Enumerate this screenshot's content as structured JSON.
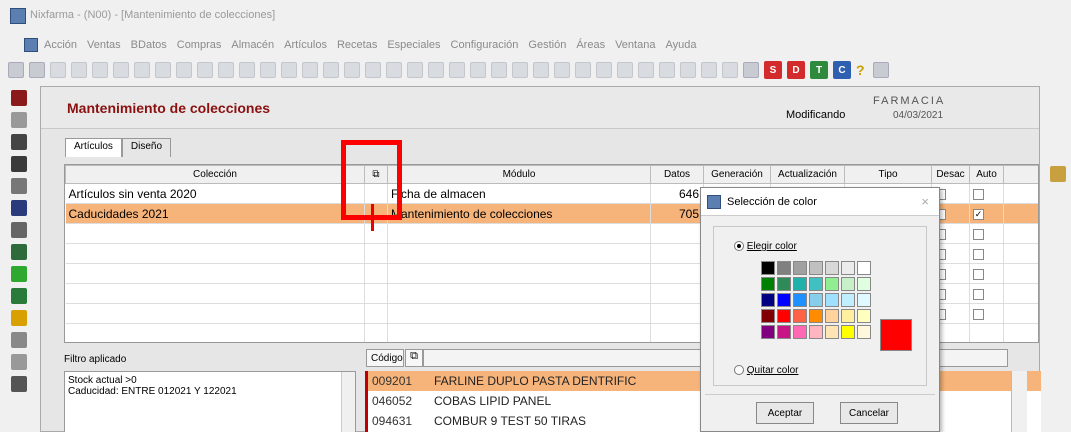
{
  "window": {
    "title": "Nixfarma - (N00) - [Mantenimiento de colecciones]"
  },
  "menu": [
    "Acción",
    "Ventas",
    "BDatos",
    "Compras",
    "Almacén",
    "Artículos",
    "Recetas",
    "Especiales",
    "Configuración",
    "Gestión",
    "Áreas",
    "Ventana",
    "Ayuda"
  ],
  "toolbar": {
    "help_glyph": "?"
  },
  "form": {
    "title": "Mantenimiento de colecciones",
    "mode": "Modificando",
    "pharmacy": "FARMACIA",
    "date": "04/03/2021"
  },
  "tabs": [
    "Artículos",
    "Diseño"
  ],
  "grid": {
    "columns": [
      "Colección",
      "Módulo",
      "Datos",
      "Generación",
      "Actualización",
      "Tipo",
      "Desac",
      "Auto"
    ],
    "rows": [
      {
        "coleccion": "Artículos sin venta 2020",
        "modulo": "Ficha de almacen",
        "datos": "646",
        "auto": ""
      },
      {
        "coleccion": "Caducidades 2021",
        "modulo": "Mantenimiento de colecciones",
        "datos": "705",
        "auto": "✓"
      }
    ]
  },
  "filter": {
    "label": "Filtro aplicado",
    "lines": [
      "Stock actual >0",
      "Caducidad: ENTRE 012021 Y 122021"
    ]
  },
  "products": {
    "header": "Código",
    "rows": [
      {
        "code": "009201",
        "name": "FARLINE DUPLO PASTA DENTRIFIC"
      },
      {
        "code": "046052",
        "name": "COBAS LIPID PANEL"
      },
      {
        "code": "094631",
        "name": "COMBUR 9 TEST 50 TIRAS"
      }
    ]
  },
  "color_dialog": {
    "title": "Selección de color",
    "close": "×",
    "option_choose": "Elegir color",
    "option_remove": "Quitar color",
    "accept": "Aceptar",
    "cancel": "Cancelar",
    "selected_color": "#ff0000",
    "palette": [
      "#000000",
      "#808080",
      "#a0a0a0",
      "#c0c0c0",
      "#d8d8d8",
      "#ececec",
      "#ffffff",
      "#008000",
      "#2e8b57",
      "#20b2aa",
      "#40c0c0",
      "#90ee90",
      "#c8f0c8",
      "#e0ffe0",
      "#000080",
      "#0000ff",
      "#1e90ff",
      "#87ceeb",
      "#a0e0ff",
      "#c0f0ff",
      "#e0f8ff",
      "#800000",
      "#ff0000",
      "#ff6347",
      "#ff8c00",
      "#ffd39b",
      "#fff0a0",
      "#ffffc0",
      "#800080",
      "#c71585",
      "#ff69b4",
      "#ffb6c1",
      "#ffe4b5",
      "#ffff00",
      "#fff8dc"
    ]
  }
}
